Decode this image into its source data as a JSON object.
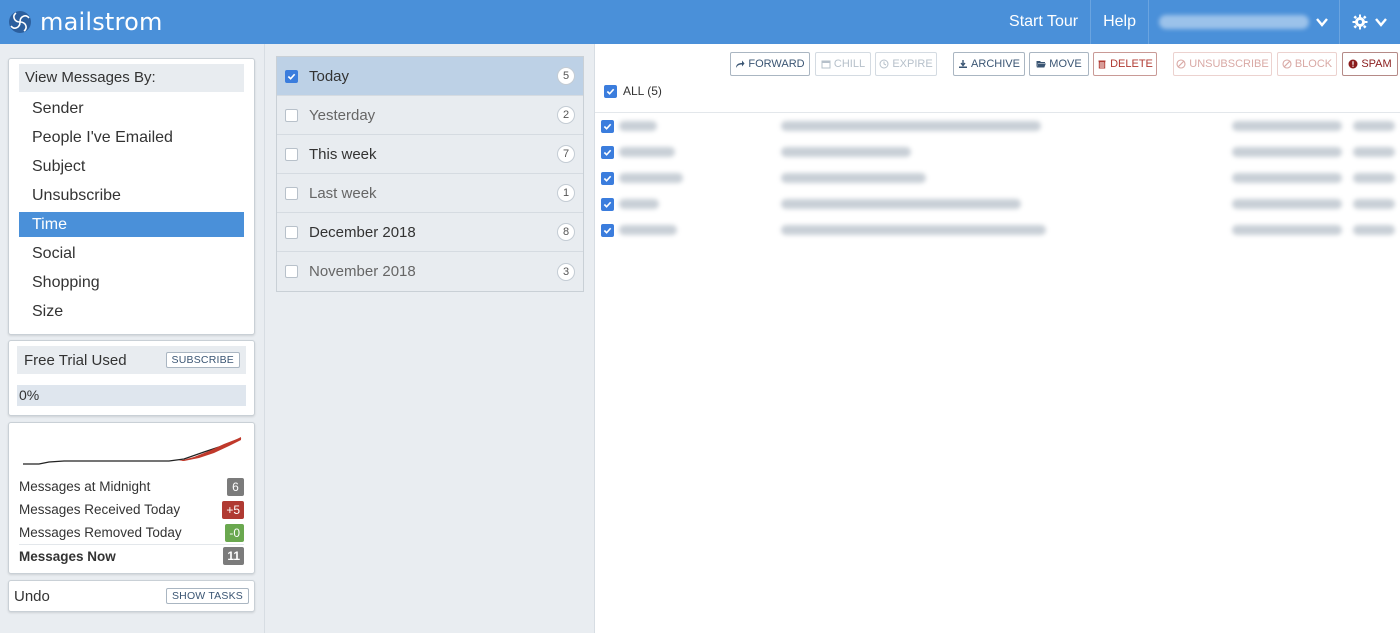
{
  "header": {
    "brand": "mailstrom",
    "start_tour": "Start Tour",
    "help": "Help"
  },
  "view_by": {
    "title": "View Messages By:",
    "items": [
      "Sender",
      "People I've Emailed",
      "Subject",
      "Unsubscribe",
      "Time",
      "Social",
      "Shopping",
      "Size"
    ],
    "active": "Time"
  },
  "trial": {
    "label": "Free Trial Used",
    "subscribe": "SUBSCRIBE",
    "progress_text": "0%",
    "progress_value": 0
  },
  "stats": {
    "sparkline_colors": {
      "line": "#222222",
      "gain": "#c0392b"
    },
    "rows": [
      {
        "label": "Messages at Midnight",
        "value": "6",
        "color": "#7b7b7b"
      },
      {
        "label": "Messages Received Today",
        "value": "+5",
        "color": "#b03a32"
      },
      {
        "label": "Messages Removed Today",
        "value": "-0",
        "color": "#6aa84f"
      },
      {
        "label": "Messages Now",
        "value": "11",
        "color": "#7b7b7b"
      }
    ]
  },
  "undo": {
    "label": "Undo",
    "show_tasks": "SHOW TASKS"
  },
  "time_groups": [
    {
      "label": "Today",
      "count": "5",
      "checked": true,
      "selected": true
    },
    {
      "label": "Yesterday",
      "count": "2",
      "checked": false,
      "selected": false,
      "dim": true
    },
    {
      "label": "This week",
      "count": "7",
      "checked": false,
      "selected": false
    },
    {
      "label": "Last week",
      "count": "1",
      "checked": false,
      "selected": false,
      "dim": true
    },
    {
      "label": "December 2018",
      "count": "8",
      "checked": false,
      "selected": false
    },
    {
      "label": "November 2018",
      "count": "3",
      "checked": false,
      "selected": false,
      "dim": true
    }
  ],
  "toolbar": {
    "forward": "FORWARD",
    "chill": "CHILL",
    "expire": "EXPIRE",
    "archive": "ARCHIVE",
    "move": "MOVE",
    "delete": "DELETE",
    "unsubscribe": "UNSUBSCRIBE",
    "block": "BLOCK",
    "spam": "SPAM"
  },
  "all_label": "ALL (5)",
  "messages_count": 5,
  "colors": {
    "accent": "#4a90d9",
    "selected_row": "#bdd1e6",
    "checkbox": "#3b7ddd"
  }
}
